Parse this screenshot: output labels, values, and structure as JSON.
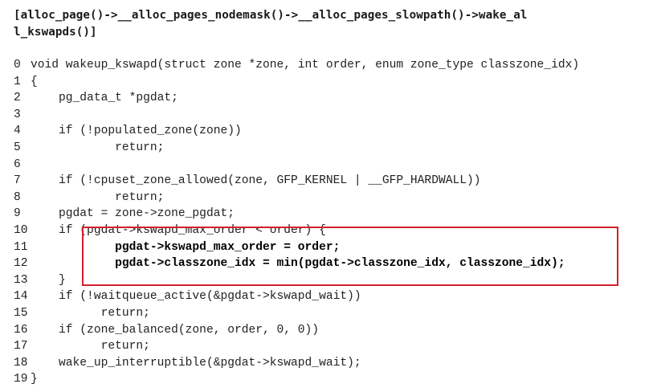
{
  "heading": {
    "line1": "[alloc_page()->__alloc_pages_nodemask()->__alloc_pages_slowpath()->wake_al",
    "line2": "l_kswapds()]"
  },
  "code": [
    {
      "num": "0",
      "text": "void wakeup_kswapd(struct zone *zone, int order, enum zone_type classzone_idx)"
    },
    {
      "num": "1",
      "text": "{"
    },
    {
      "num": "2",
      "text": "    pg_data_t *pgdat;"
    },
    {
      "num": "3",
      "text": ""
    },
    {
      "num": "4",
      "text": "    if (!populated_zone(zone))"
    },
    {
      "num": "5",
      "text": "            return;"
    },
    {
      "num": "6",
      "text": ""
    },
    {
      "num": "7",
      "text": "    if (!cpuset_zone_allowed(zone, GFP_KERNEL | __GFP_HARDWALL))"
    },
    {
      "num": "8",
      "text": "            return;"
    },
    {
      "num": "9",
      "text": "    pgdat = zone->zone_pgdat;"
    },
    {
      "num": "10",
      "text": "    if (pgdat->kswapd_max_order < order) {"
    },
    {
      "num": "11",
      "text": "            pgdat->kswapd_max_order = order;"
    },
    {
      "num": "12",
      "text": "            pgdat->classzone_idx = min(pgdat->classzone_idx, classzone_idx);"
    },
    {
      "num": "13",
      "text": "    }"
    },
    {
      "num": "14",
      "text": "    if (!waitqueue_active(&pgdat->kswapd_wait))"
    },
    {
      "num": "15",
      "text": "          return;"
    },
    {
      "num": "16",
      "text": "    if (zone_balanced(zone, order, 0, 0))"
    },
    {
      "num": "17",
      "text": "          return;"
    },
    {
      "num": "18",
      "text": "    wake_up_interruptible(&pgdat->kswapd_wait);"
    },
    {
      "num": "19",
      "text": "}"
    }
  ],
  "highlight": {
    "lines": [
      11,
      12
    ],
    "color": "#d3202c"
  }
}
